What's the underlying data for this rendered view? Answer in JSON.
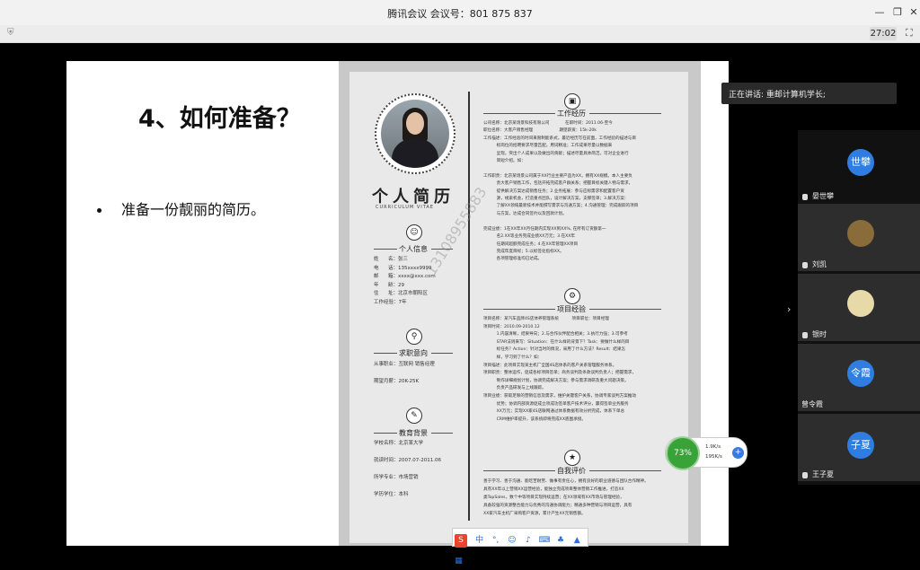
{
  "window": {
    "title": "腾讯会议 会议号：801 875 837",
    "timer": "27:02"
  },
  "slide": {
    "title": "4、如何准备？",
    "bullet": "准备一份靓丽的简历。"
  },
  "resume": {
    "title": "个人简历",
    "subtitle": "CURRICULUM VITAE",
    "watermark": "13108955883",
    "sections": {
      "personal": "个人信息",
      "intent": "求职意向",
      "education": "教育背景",
      "work": "工作经历",
      "project": "项目经验",
      "review": "自我评价"
    },
    "personal_lines": "姓      名：张三\n电      话：135xxxx9999\n邮      箱：xxxx@xxx.com\n年      龄：29\n住      址：北京市朝阳区\n工作经验：7年",
    "intent_lines": "从事职业：互联网 销售经理\n\n期望月薪：20K-25K",
    "education_lines": "学校名称：北京某大学\n\n就读时间：2007.07-2011.06\n\n所学专业：市场营销\n\n学历学位：本科",
    "work_lines": "公司名称：北京某场景科技有限公司            在职时间：2011.06-至今\n职位名称：大客户销售经理                    期望薪资：15k-20k\n工作描述：工作经验的时间来限制能系式，最近经历写在前面，工作经验的描述与目\n          标岗位的招聘要求尽量匹配，用词精准；工作成果尽量以数据来\n          呈现，突出个人成果以及做出的贡献；描述尽量具体简洁。可对企业进行\n          简短介绍。如：\n\n工作职责：北京某场景公司属于XX行业主要产品为XX，拥有XX规模。本人主要负\n          责大客户销售工作，包括开拓完成客户群关系；把握目标关键人物与需求，\n          提供解决方案达成销售任务；2.业务拓展：参与应标需求和配置客户资\n          源，线索机会，打造重点团队，设计解决方案，支撑签单；3.解决方案：\n          了解XX领域最新技术并能撰写需求与沟通方案；4.沟通管理：完成跟踪的项目\n          与方案，达成合同签约以及回款计划。\n\n完成业绩：1在XX年XX月任期内实现XX到XX%, 在所有订货额第一\n          名2.XX等业务完成业绩XX万元；3.在XX年\n          任期间超额完成任务；4.在XX年管理XX项目\n          完成年度目标；5.以标签化指标XX。\n          各项管理标准均已达成。",
    "project_lines": "项目名称：某汽车品牌4S店体养管理系统          项目职位：项目经理\n项目时间：2010.09-2010.12\n          1.内容清晰，结果导向；2.与合作伙伴配合相关；3.执行力强；3.可参考\n          STAR法则来写：Situation：在什么样的背景下？Task：要做什么样的目\n          标任务？Action：针对当时的情况，采用了什么方法？Result：结果怎\n          样，学习到了什么？如：\n项目描述：此项目实现某主机厂全国4S店体系的客户关系管理服务体系。\n项目职责：整体运作，促成各标项目签单；商务谈判及条款谈判负责人；把握需求，\n          制作详细规划计划，协调完成解决方案；参与需求调研及重大问题决策，\n          负责产品研发与上线跟踪。\n项目业绩：获取足够的营销信息及需求，维护关键客户关系，协调专家谈判方案推动\n          优势；协调内部资源促成立项成功签单客户技术评分，赢得签单业务服务\n          XX万元；实现XX家4S店联网通过体系数据有效分析完成，体系下单总\n          CRM维护率提升，该系统即将完成XX底图承接。",
    "review_lines": "善于学习、善于沟通、能吃苦耐劳、做事有责任心，拥有良好的职业道德与团队合作精神。\n具有XX年以上营销XX运营经验，能独立完成项目整体营销工作推进，打造XX\n类TopSales，数个中等项目实现持续运营；在XX领域有XX市场与管理经验，\n具备较强的资源整合能力与优秀的沟通协调能力；精通多种营销与项目运营，具有\nXX家汽车主机厂采购客户资源，累计产生XX元销售额。"
  },
  "speaker": {
    "label": "正在讲话: 重邮计算机学长;"
  },
  "participants": [
    {
      "name": "晏世攀",
      "avatar_text": "世攀",
      "color": "#2f7de1"
    },
    {
      "name": "刘凯",
      "avatar_text": "",
      "color": "#8a6b3a"
    },
    {
      "name": "银时",
      "avatar_text": "",
      "color": "#e8d9a8"
    },
    {
      "name": "曾令霞",
      "avatar_text": "令霞",
      "color": "#2f7de1"
    },
    {
      "name": "王子夏",
      "avatar_text": "子夏",
      "color": "#2f7de1"
    }
  ],
  "network": {
    "percent": "73%",
    "up": "1.9K/s",
    "down": "195K/s"
  },
  "ime": {
    "lang": "中"
  }
}
